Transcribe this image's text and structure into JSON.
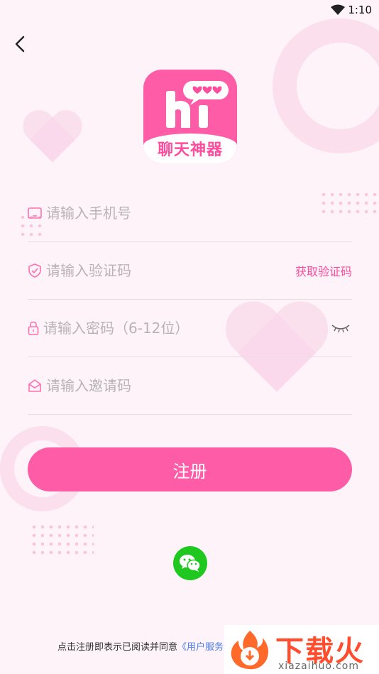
{
  "status_bar": {
    "time": "1:10",
    "wifi_icon": "wifi-icon"
  },
  "logo": {
    "text": "聊天神器",
    "wordmark": "hi"
  },
  "form": {
    "phone": {
      "placeholder": "请输入手机号",
      "value": ""
    },
    "code": {
      "placeholder": "请输入验证码",
      "value": "",
      "get_code_label": "获取验证码"
    },
    "password": {
      "placeholder": "请输入密码（6-12位）",
      "value": ""
    },
    "invite": {
      "placeholder": "请输入邀请码",
      "value": ""
    }
  },
  "register_label": "注册",
  "agreement": {
    "text": "点击注册即表示已阅读并同意",
    "link": "《用户服务"
  },
  "watermark": {
    "title": "下载火",
    "subtitle": "xiazaihuo.com"
  },
  "colors": {
    "accent": "#ff5ca8",
    "wechat": "#1fc81f",
    "link": "#4a7ff0"
  }
}
